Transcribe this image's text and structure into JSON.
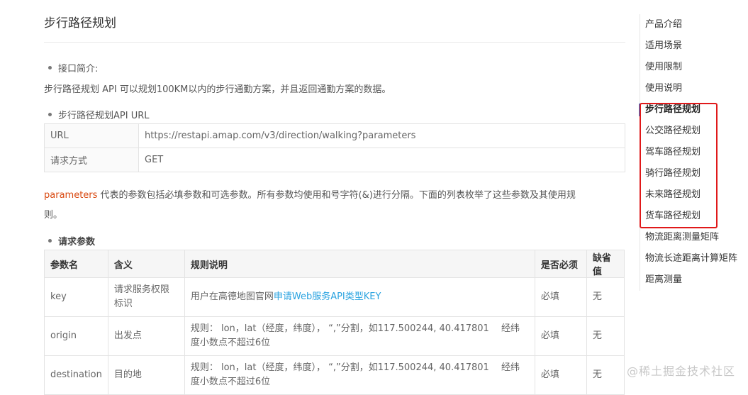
{
  "page_title": "步行路径规划",
  "intro": {
    "bullet": "接口简介:",
    "text": "步行路径规划 API 可以规划100KM以内的步行通勤方案，并且返回通勤方案的数据。"
  },
  "url_section": {
    "bullet": "步行路径规划API URL",
    "rows": [
      {
        "key": "URL",
        "value": "https://restapi.amap.com/v3/direction/walking?parameters"
      },
      {
        "key": "请求方式",
        "value": "GET"
      }
    ]
  },
  "parameters_note": {
    "keyword": "parameters",
    "line1": " 代表的参数包括必填参数和可选参数。所有参数均使用和号字符(&)进行分隔。下面的列表枚举了这些参数及其使用规",
    "line2": "则。"
  },
  "request_params": {
    "bullet": "请求参数",
    "headers": [
      "参数名",
      "含义",
      "规则说明",
      "是否必须",
      "缺省值"
    ],
    "rows": [
      {
        "name": "key",
        "meaning_l1": "请求服务权限",
        "meaning_l2": "标识",
        "rule_prefix": "用户在高德地图官网",
        "rule_link": "申请Web服务API类型KEY",
        "rule_l2": "",
        "required": "必填",
        "default": "无"
      },
      {
        "name": "origin",
        "meaning_l1": "出发点",
        "meaning_l2": "",
        "rule_prefix": "规则： lon，lat（经度，纬度）， “,”分割，如117.500244, 40.417801　 经纬",
        "rule_link": "",
        "rule_l2": "度小数点不超过6位",
        "required": "必填",
        "default": "无"
      },
      {
        "name": "destination",
        "meaning_l1": "目的地",
        "meaning_l2": "",
        "rule_prefix": "规则： lon，lat（经度，纬度）， “,”分割，如117.500244, 40.417801　 经纬",
        "rule_link": "",
        "rule_l2": "度小数点不超过6位",
        "required": "必填",
        "default": "无"
      }
    ]
  },
  "toc": {
    "items": [
      "产品介绍",
      "适用场景",
      "使用限制",
      "使用说明",
      "步行路径规划",
      "公交路径规划",
      "驾车路径规划",
      "骑行路径规划",
      "未来路径规划",
      "货车路径规划",
      "物流距离测量矩阵",
      "物流长途距离计算矩阵",
      "距离测量"
    ],
    "active_index": 4
  },
  "watermark": "@稀土掘金技术社区",
  "colors": {
    "link": "#2aa3e0",
    "param_keyword": "#d9480f",
    "highlight_box": "#e0191a",
    "active_marker": "#2d7be5"
  }
}
